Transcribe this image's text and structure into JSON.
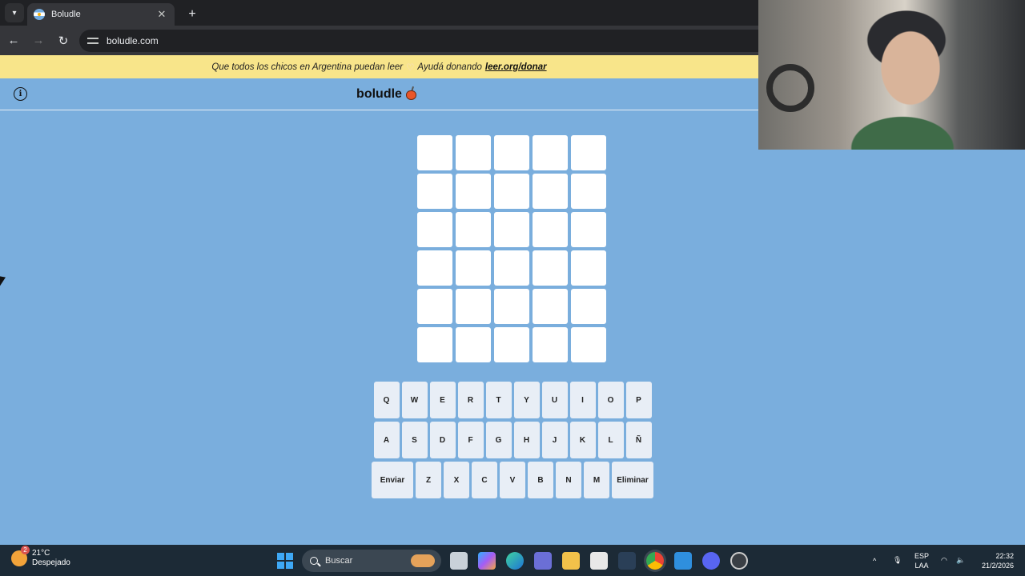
{
  "browser": {
    "tab_title": "Boludle",
    "tab_close": "✕",
    "new_tab": "+",
    "url": "boludle.com"
  },
  "banner": {
    "text": "Que todos los chicos en Argentina puedan leer",
    "heart": "♡",
    "donate_text": "Ayudá donando",
    "donate_link": "leer.org/donar"
  },
  "header": {
    "title": "boludle",
    "info_glyph": "i"
  },
  "board": {
    "rows": [
      [
        "",
        "",
        "",
        "",
        ""
      ],
      [
        "",
        "",
        "",
        "",
        ""
      ],
      [
        "",
        "",
        "",
        "",
        ""
      ],
      [
        "",
        "",
        "",
        "",
        ""
      ],
      [
        "",
        "",
        "",
        "",
        ""
      ],
      [
        "",
        "",
        "",
        "",
        ""
      ]
    ]
  },
  "keyboard": {
    "row1": [
      "Q",
      "W",
      "E",
      "R",
      "T",
      "Y",
      "U",
      "I",
      "O",
      "P"
    ],
    "row2": [
      "A",
      "S",
      "D",
      "F",
      "G",
      "H",
      "J",
      "K",
      "L",
      "Ñ"
    ],
    "row3": [
      "Enviar",
      "Z",
      "X",
      "C",
      "V",
      "B",
      "N",
      "M",
      "Eliminar"
    ]
  },
  "taskbar": {
    "weather_temp": "21°C",
    "weather_desc": "Despejado",
    "weather_badge": "2",
    "search_placeholder": "Buscar",
    "lang_1": "ESP",
    "lang_2": "LAA",
    "time": "22:32",
    "date": "21/2/2026",
    "tray_up": "^"
  }
}
